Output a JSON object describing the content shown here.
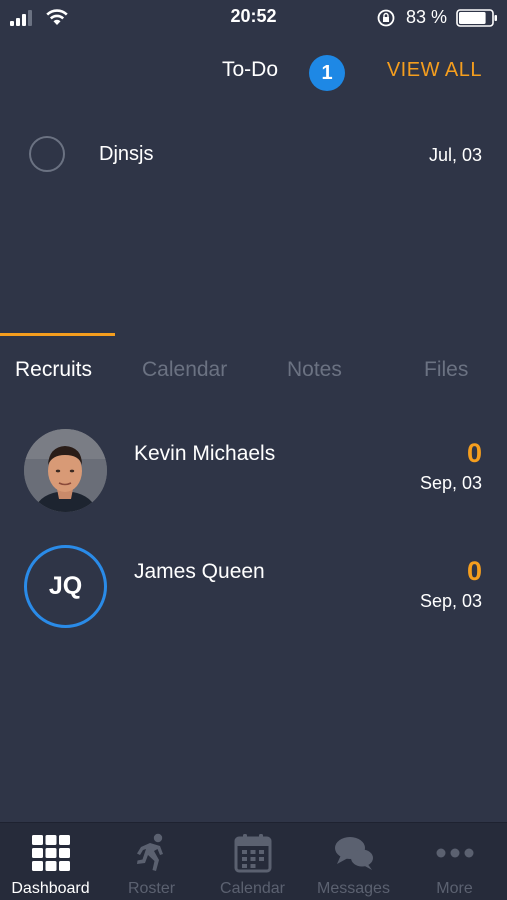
{
  "status_bar": {
    "time": "20:52",
    "battery_percent": "83 %",
    "battery_level": 0.83
  },
  "todo": {
    "title": "To-Do",
    "badge_count": "1",
    "view_all_label": "VIEW ALL",
    "items": [
      {
        "text": "Djnsjs",
        "date": "Jul, 03",
        "completed": false
      }
    ]
  },
  "tabs": [
    {
      "label": "Recruits",
      "active": true
    },
    {
      "label": "Calendar",
      "active": false
    },
    {
      "label": "Notes",
      "active": false
    },
    {
      "label": "Files",
      "active": false
    }
  ],
  "recruits": [
    {
      "name": "Kevin Michaels",
      "count": "0",
      "date": "Sep, 03",
      "avatar": "photo"
    },
    {
      "name": "James Queen",
      "count": "0",
      "date": "Sep, 03",
      "avatar": "initials",
      "initials": "JQ"
    }
  ],
  "bottom_nav": [
    {
      "label": "Dashboard",
      "icon": "grid-icon",
      "active": true
    },
    {
      "label": "Roster",
      "icon": "runner-icon",
      "active": false
    },
    {
      "label": "Calendar",
      "icon": "calendar-icon",
      "active": false
    },
    {
      "label": "Messages",
      "icon": "chat-bubbles-icon",
      "active": false
    },
    {
      "label": "More",
      "icon": "more-dots-icon",
      "active": false
    }
  ],
  "colors": {
    "background": "#2f3547",
    "accent": "#f59e1e",
    "badge_blue": "#1e88e5",
    "inactive": "#6b7282",
    "nav_background": "#262b3a"
  }
}
